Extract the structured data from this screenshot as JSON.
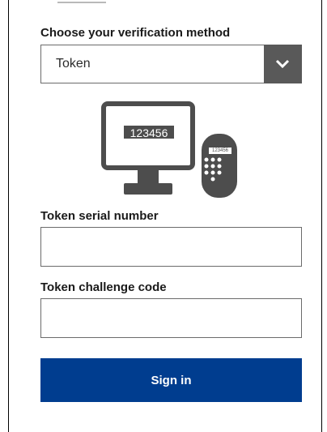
{
  "verification": {
    "label": "Choose your verification method",
    "selected": "Token"
  },
  "illustration": {
    "screen_code": "123456",
    "token_code": "123456"
  },
  "serial": {
    "label": "Token serial number",
    "value": ""
  },
  "challenge": {
    "label": "Token challenge code",
    "value": ""
  },
  "actions": {
    "sign_in_label": "Sign in"
  },
  "colors": {
    "primary": "#003d8f",
    "dropdown_button": "#595959",
    "illustration": "#4d4d4d"
  },
  "icons": {
    "dropdown": "chevron-down-icon",
    "illustration": "monitor-and-token-icon"
  }
}
